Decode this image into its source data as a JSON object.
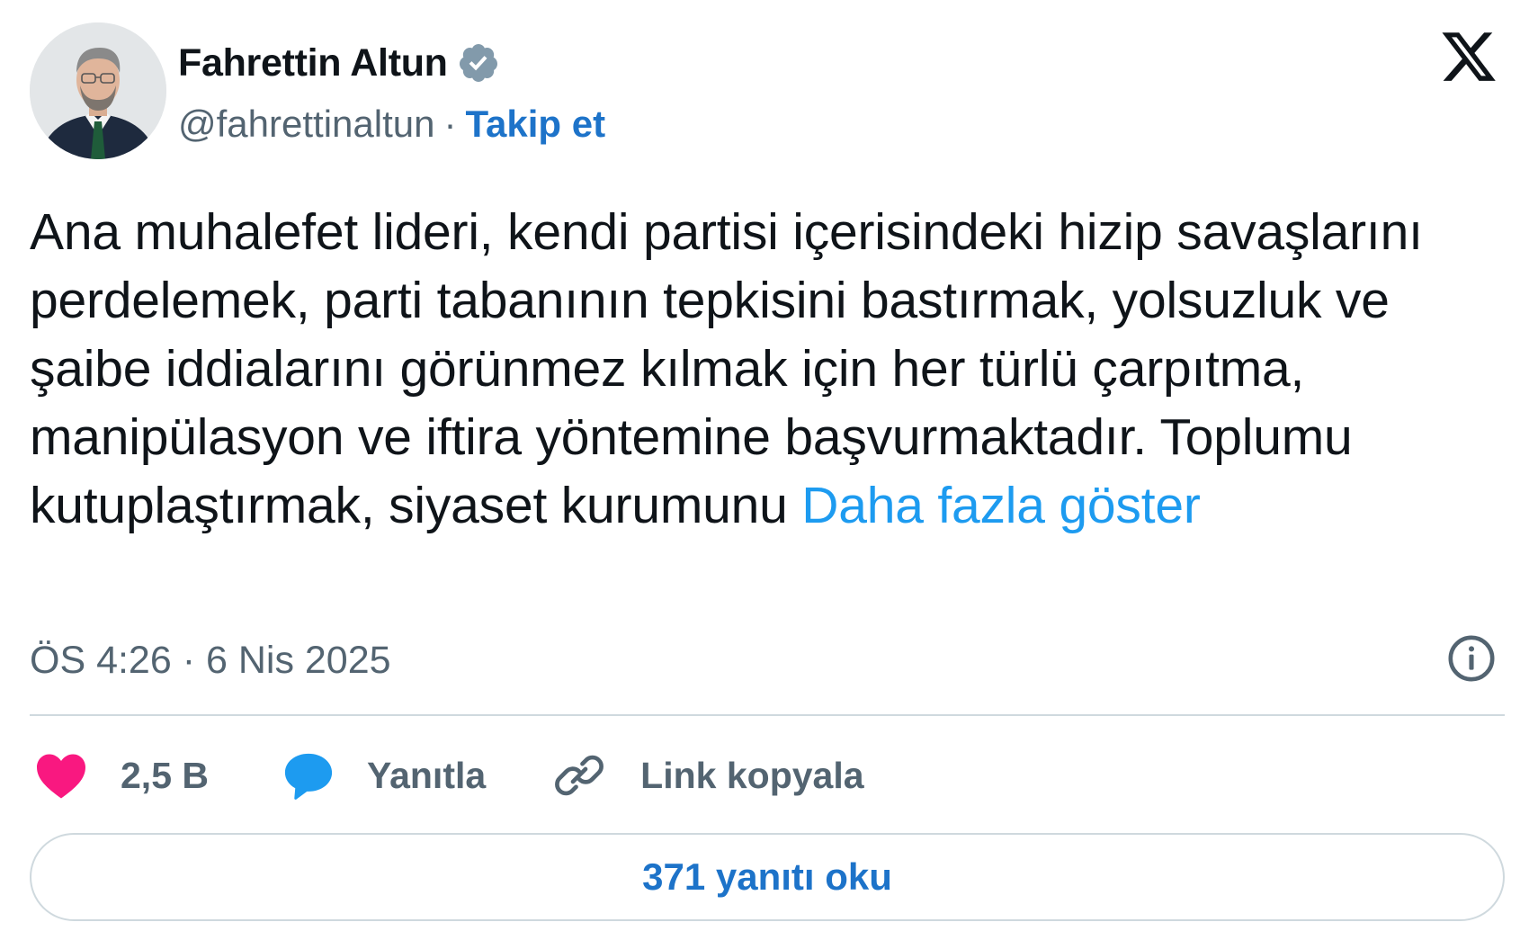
{
  "author": {
    "name": "Fahrettin Altun",
    "handle": "@fahrettinaltun",
    "separator": "·",
    "follow_label": "Takip et",
    "verified": true,
    "avatar_icon": "profile-photo"
  },
  "brand": {
    "logo_icon": "x-logo-icon"
  },
  "tweet": {
    "text": "Ana muhalefet lideri, kendi partisi içerisindeki hizip savaşlarını perdelemek, parti tabanının tepkisini bastırmak, yolsuzluk ve şaibe iddialarını görünmez kılmak için her türlü çarpıtma, manipülasyon ve iftira yöntemine başvurmaktadır. Toplumu kutuplaştırmak, siyaset kurumunu",
    "show_more_label": "Daha fazla göster",
    "timestamp": "ÖS 4:26 · 6 Nis 2025"
  },
  "actions": {
    "like_count": "2,5 B",
    "reply_label": "Yanıtla",
    "copy_link_label": "Link kopyala"
  },
  "footer": {
    "read_replies_label": "371 yanıtı oku"
  },
  "colors": {
    "text_primary": "#0f1419",
    "text_secondary": "#536471",
    "link_blue": "#1d9bf0",
    "follow_blue": "#1d73c9",
    "like_pink": "#f91880",
    "reply_blue": "#1d9bf0",
    "border": "#cfd9de",
    "verified_gray": "#829aab"
  }
}
